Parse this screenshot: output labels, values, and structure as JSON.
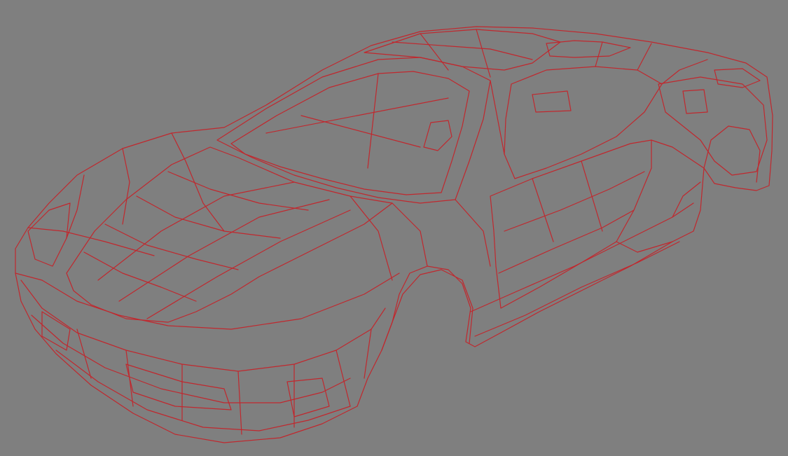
{
  "viewport": {
    "background_color": "#7f7f7f",
    "wire_color": "#c0282e",
    "render_mode": "wireframe",
    "subject": "car-body-mesh"
  }
}
